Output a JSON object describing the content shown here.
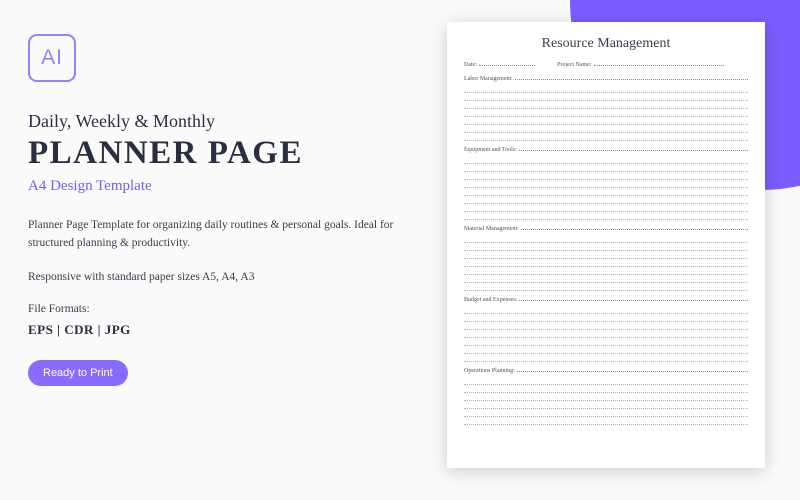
{
  "badge": {
    "label": "AI"
  },
  "heading": {
    "small": "Daily, Weekly & Monthly",
    "large": "PLANNER PAGE"
  },
  "subtitle": "A4 Design Template",
  "description1": "Planner Page Template for organizing daily routines & personal goals. Ideal for structured planning & productivity.",
  "description2": "Responsive with standard paper sizes A5, A4, A3",
  "formats": {
    "label": "File Formats:",
    "list": "EPS  |  CDR  |  JPG"
  },
  "print_badge": "Ready to Print",
  "planner": {
    "title": "Resource Management",
    "meta": {
      "date_label": "Date:",
      "project_label": "Project Name:"
    },
    "sections": [
      {
        "label": "Labor Management:",
        "lines": 7
      },
      {
        "label": "Equipment and Tools:",
        "lines": 8
      },
      {
        "label": "Material Management:",
        "lines": 7
      },
      {
        "label": "Budget and Expenses:",
        "lines": 7
      },
      {
        "label": "Operations Planning:",
        "lines": 6
      }
    ]
  }
}
